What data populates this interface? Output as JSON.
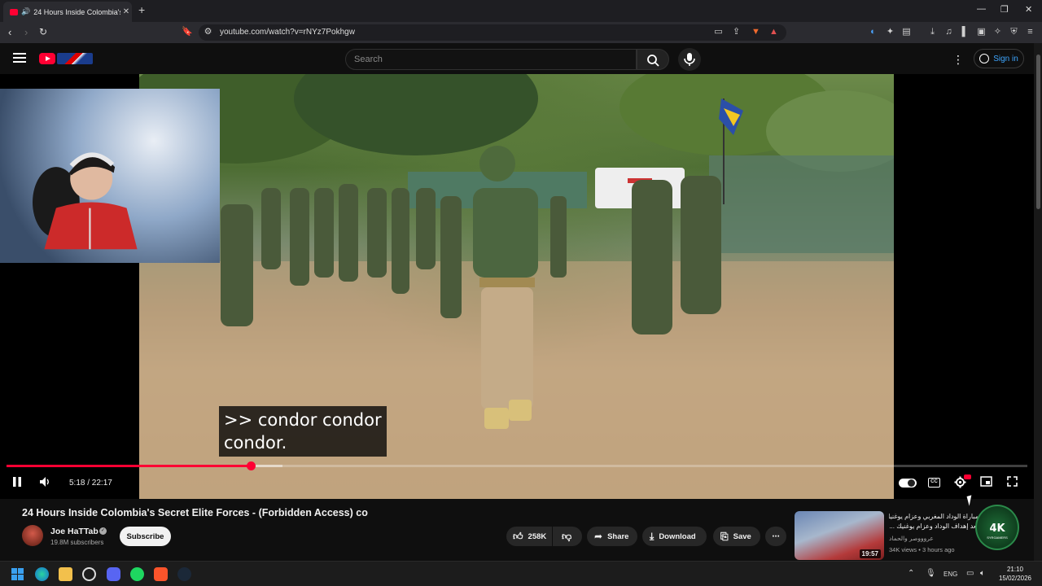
{
  "browser": {
    "tab_title": "24 Hours Inside Colombia's S",
    "tab_close": "✕",
    "new_tab": "+",
    "url": "youtube.com/watch?v=rNYz7Pokhgw"
  },
  "youtube": {
    "search_placeholder": "Search",
    "sign_in": "Sign in"
  },
  "player": {
    "caption_line1": ">> condor condor",
    "caption_line2": "condor.",
    "time": "5:18 / 22:17",
    "progress": 0.2392,
    "buffered": 0.27
  },
  "video": {
    "title": "24 Hours Inside Colombia's Secret Elite Forces - (Forbidden Access) co",
    "channel": "Joe HaTTab",
    "subscribers": "19.8M subscribers",
    "subscribe_label": "Subscribe",
    "likes": "258K",
    "share_label": "Share",
    "download_label": "Download",
    "save_label": "Save"
  },
  "recommended": {
    "title_line1": "مباراة الوداد المغربي وعزام يوغنيك",
    "title_line2": "بعد إهداف الوداد وعزام يوغنيك ...",
    "channel": "عروووصر والحماد",
    "meta": "34K views • 3 hours ago",
    "duration": "19:57",
    "logo_text": "4K",
    "logo_sub": "SYRGAMERS"
  },
  "taskbar": {
    "lang": "ENG",
    "time": "21:10",
    "date": "15/02/2026"
  },
  "colors": {
    "accent_red": "#ff0033",
    "link_blue": "#3ea6ff"
  }
}
